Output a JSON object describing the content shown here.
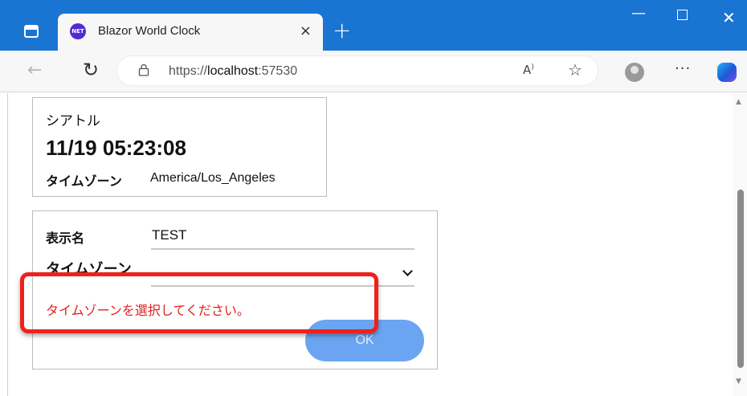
{
  "browser": {
    "tab_title": "Blazor World Clock",
    "favicon_text": "NET",
    "url_prefix": "https://",
    "url_host": "localhost",
    "url_port": ":57530",
    "close_glyph": "×",
    "new_tab_glyph": "+",
    "minimize_glyph": "—",
    "close_window_glyph": "✕",
    "back_glyph": "←",
    "reload_glyph": "↻",
    "lock_glyph": "🔒",
    "read_aloud_glyph": "A",
    "star_glyph": "☆",
    "more_glyph": "···"
  },
  "clock": {
    "city": "シアトル",
    "datetime": "11/19 05:23:08",
    "timezone_label": "タイムゾーン",
    "timezone_value": "America/Los_Angeles"
  },
  "form": {
    "name_label": "表示名",
    "name_value": "TEST",
    "timezone_label": "タイムゾーン",
    "timezone_selected": "",
    "validation_message": "タイムゾーンを選択してください。",
    "ok_label": "OK"
  },
  "colors": {
    "titlebar": "#1a74d2",
    "error": "#e0201c",
    "ok_button": "#6ba5f2",
    "highlight": "#f0201a"
  },
  "icons": [
    "window-icon",
    "dotnet-favicon-icon",
    "close-icon",
    "plus-icon",
    "minimize-icon",
    "maximize-icon",
    "back-arrow-icon",
    "reload-icon",
    "lock-icon",
    "read-aloud-icon",
    "star-icon",
    "profile-icon",
    "more-icon",
    "copilot-icon",
    "chevron-down-icon",
    "scroll-up-icon",
    "scroll-down-icon"
  ]
}
